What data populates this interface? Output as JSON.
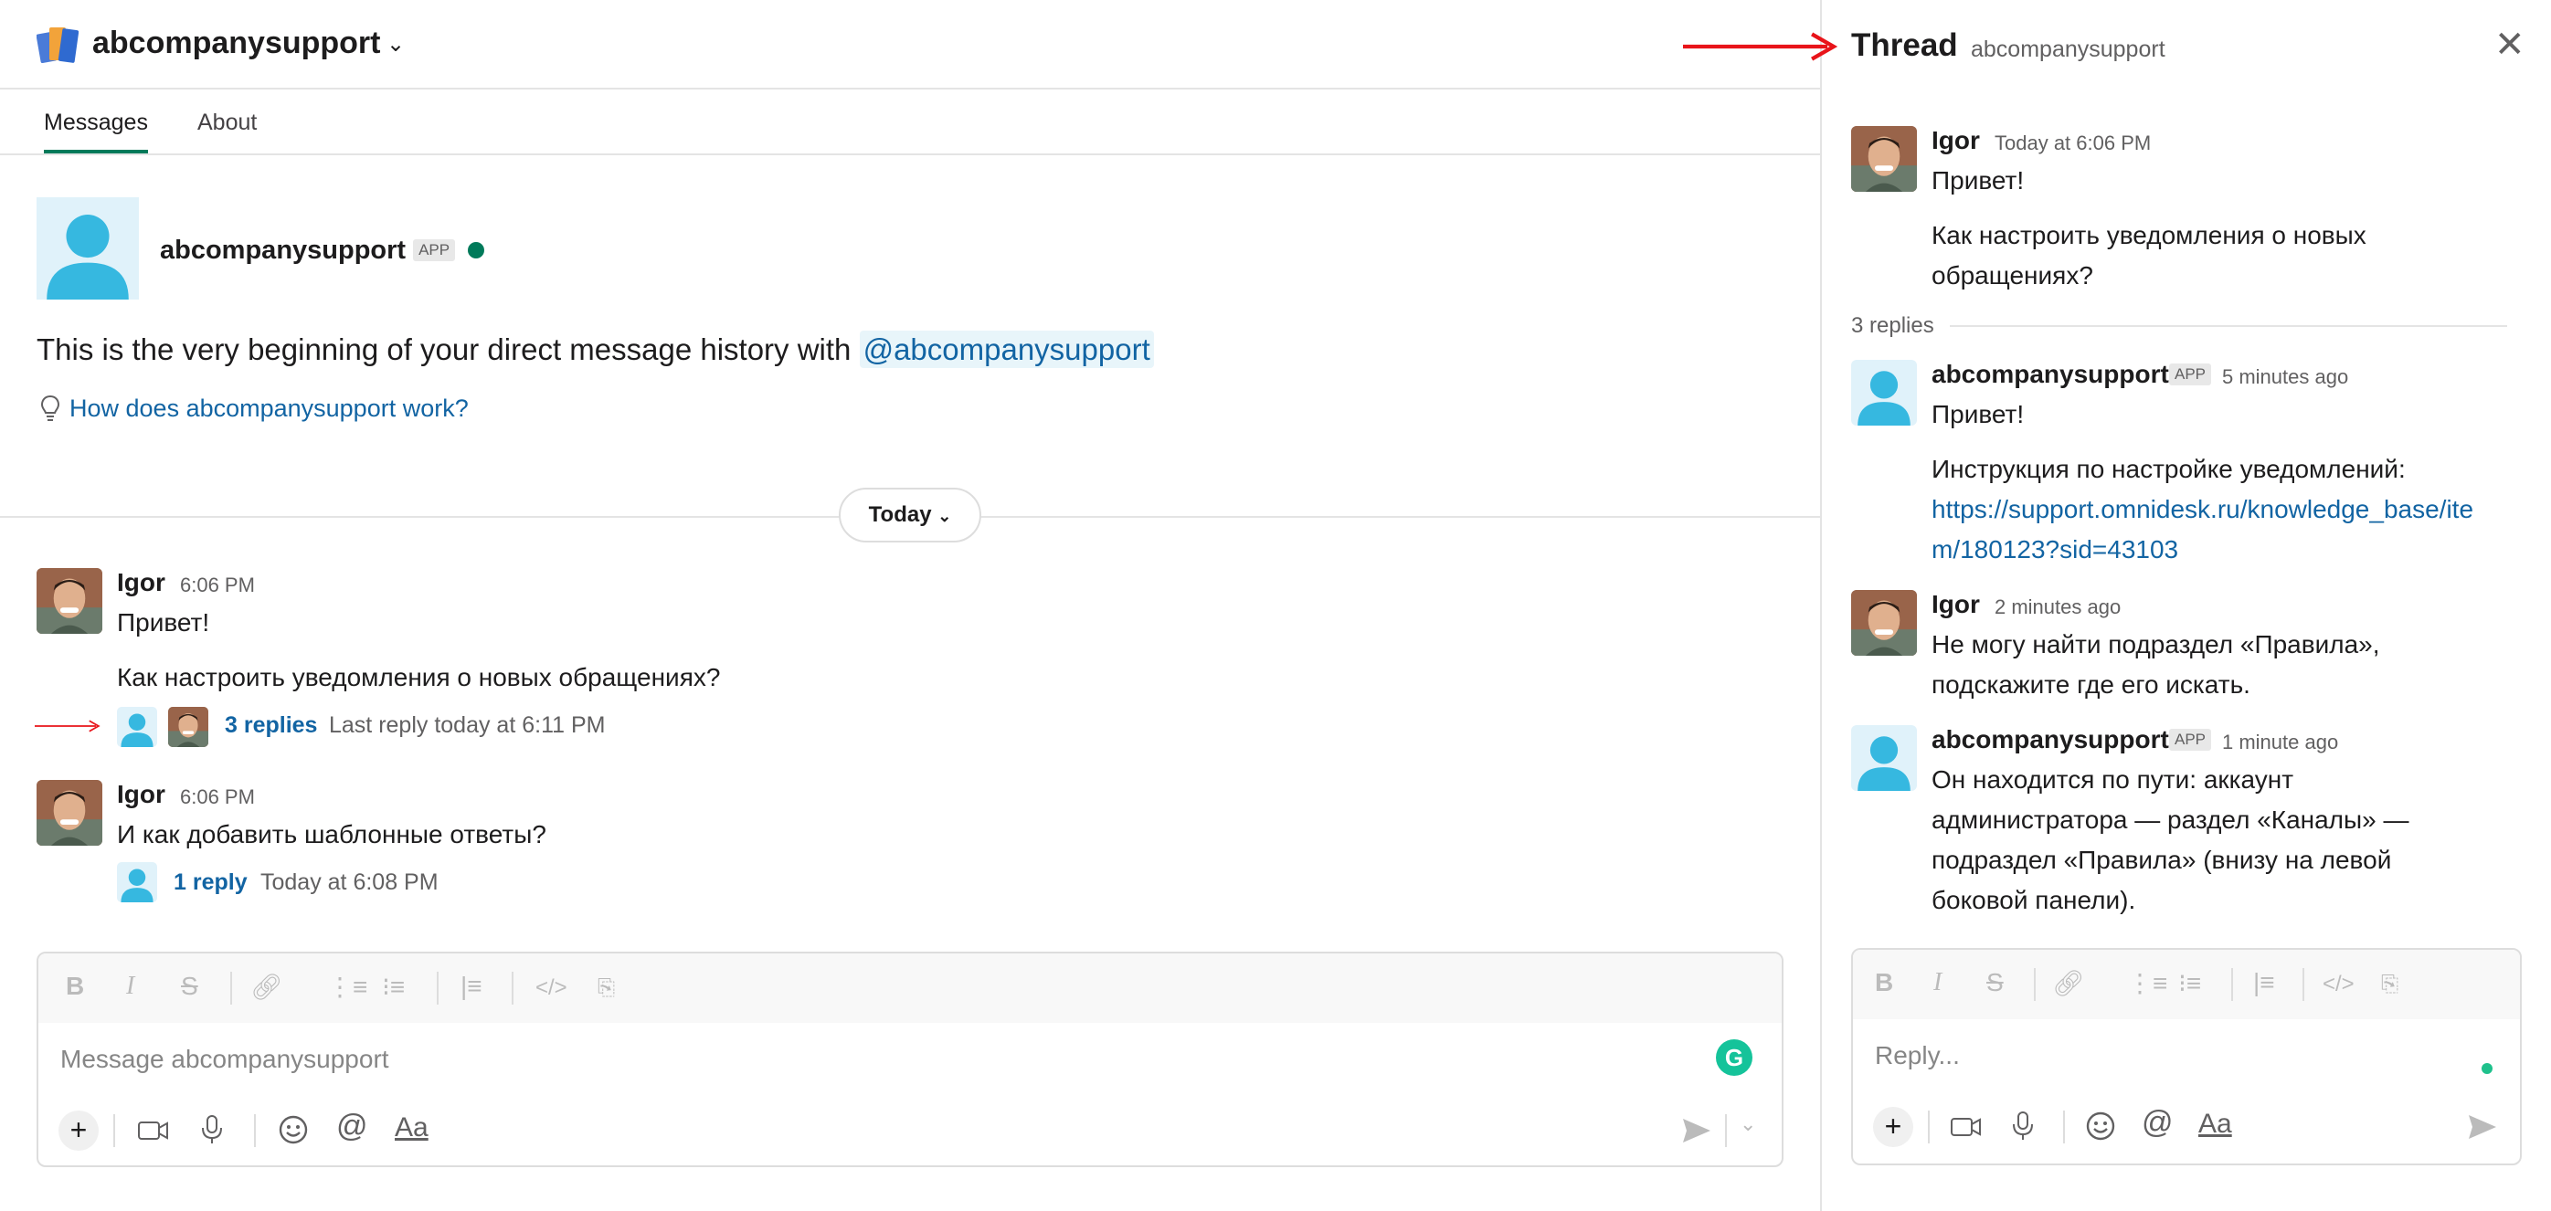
{
  "workspace": {
    "name": "abcompanysupport"
  },
  "tabs": {
    "messages": "Messages",
    "about": "About"
  },
  "intro": {
    "name": "abcompanysupport",
    "app_badge": "APP",
    "text": "This is the very beginning of your direct message history with ",
    "mention": "@abcompanysupport",
    "how_link": "How does abcompanysupport work?"
  },
  "day_divider": {
    "label": "Today"
  },
  "messages": [
    {
      "author": "Igor",
      "time": "6:06 PM",
      "lines": [
        "Привет!",
        "Как настроить уведомления о новых обращениях?"
      ],
      "replies_label": "3 replies",
      "last_reply": "Last reply today at 6:11 PM"
    },
    {
      "author": "Igor",
      "time": "6:06 PM",
      "lines": [
        "И как добавить шаблонные ответы?"
      ],
      "replies_label": "1 reply",
      "last_reply": "Today at 6:08 PM"
    }
  ],
  "composer": {
    "placeholder": "Message abcompanysupport"
  },
  "thread": {
    "title": "Thread",
    "subtitle": "abcompanysupport",
    "parent": {
      "author": "Igor",
      "time": "Today at 6:06 PM",
      "line1": "Привет!",
      "line2a": "Как настроить уведомления о новых",
      "line2b": "обращениях?"
    },
    "replies_count": "3 replies",
    "replies": [
      {
        "author": "abcompanysupport",
        "badge": "APP",
        "time": "5 minutes ago",
        "line1": "Привет!",
        "line2": "Инструкция по настройке уведомлений:",
        "link_a": "https://support.omnidesk.ru/knowledge_base/ite",
        "link_b": "m/180123?sid=43103"
      },
      {
        "author": "Igor",
        "time": "2 minutes ago",
        "line1": "Не могу найти подраздел «Правила»,",
        "line2": "подскажите где его искать."
      },
      {
        "author": "abcompanysupport",
        "badge": "APP",
        "time": "1 minute ago",
        "line1": "Он находится по пути: аккаунт",
        "line2": "администратора — раздел «Каналы» —",
        "line3": "подраздел «Правила» (внизу на левой",
        "line4": "боковой панели)."
      }
    ],
    "reply_placeholder": "Reply..."
  },
  "colors": {
    "accent_green": "#007a5a",
    "link_blue": "#1264a3",
    "avatar_blue": "#36b8e0",
    "annotation_red": "#e8141a"
  },
  "icons": [
    "workspace-logo-icon",
    "chevron-down-icon",
    "lightbulb-icon",
    "close-icon",
    "bold-icon",
    "italic-icon",
    "strike-icon",
    "link-icon",
    "ordered-list-icon",
    "bullet-list-icon",
    "blockquote-icon",
    "code-icon",
    "code-block-icon",
    "plus-icon",
    "video-icon",
    "mic-icon",
    "emoji-icon",
    "mention-icon",
    "format-icon",
    "send-icon",
    "grammarly-icon"
  ]
}
